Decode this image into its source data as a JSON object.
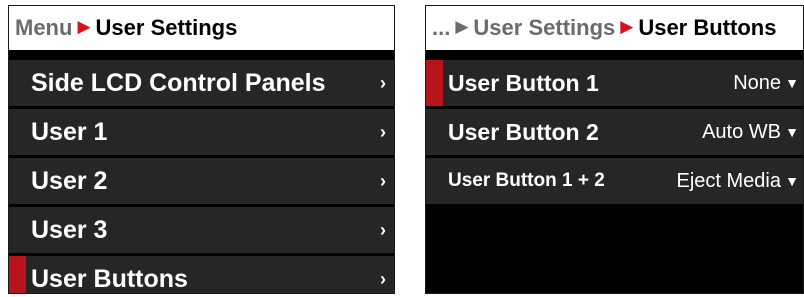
{
  "left_panel": {
    "breadcrumb": {
      "parent": "Menu",
      "current": "User Settings"
    },
    "items": [
      {
        "label": "Side LCD Control Panels",
        "chevron": "›"
      },
      {
        "label": "User 1",
        "chevron": "›"
      },
      {
        "label": "User 2",
        "chevron": "›"
      },
      {
        "label": "User 3",
        "chevron": "›"
      },
      {
        "label": "User Buttons",
        "chevron": "›",
        "selected": true
      }
    ]
  },
  "right_panel": {
    "breadcrumb": {
      "ellipsis": "...",
      "parent": "User Settings",
      "current": "User Buttons"
    },
    "items": [
      {
        "label": "User Button 1",
        "value": "None",
        "selected": true
      },
      {
        "label": "User Button 2",
        "value": "Auto WB"
      },
      {
        "label": "User Button 1 + 2",
        "value": "Eject Media"
      }
    ]
  },
  "colors": {
    "accent_red": "#d8101a",
    "selection_indicator": "#b8141c",
    "row_background": "#262626",
    "panel_background": "#000000"
  },
  "icons": {
    "breadcrumb_separator": "chevron-right-icon",
    "row_chevron": "chevron-right-icon",
    "dropdown": "chevron-down-icon"
  }
}
